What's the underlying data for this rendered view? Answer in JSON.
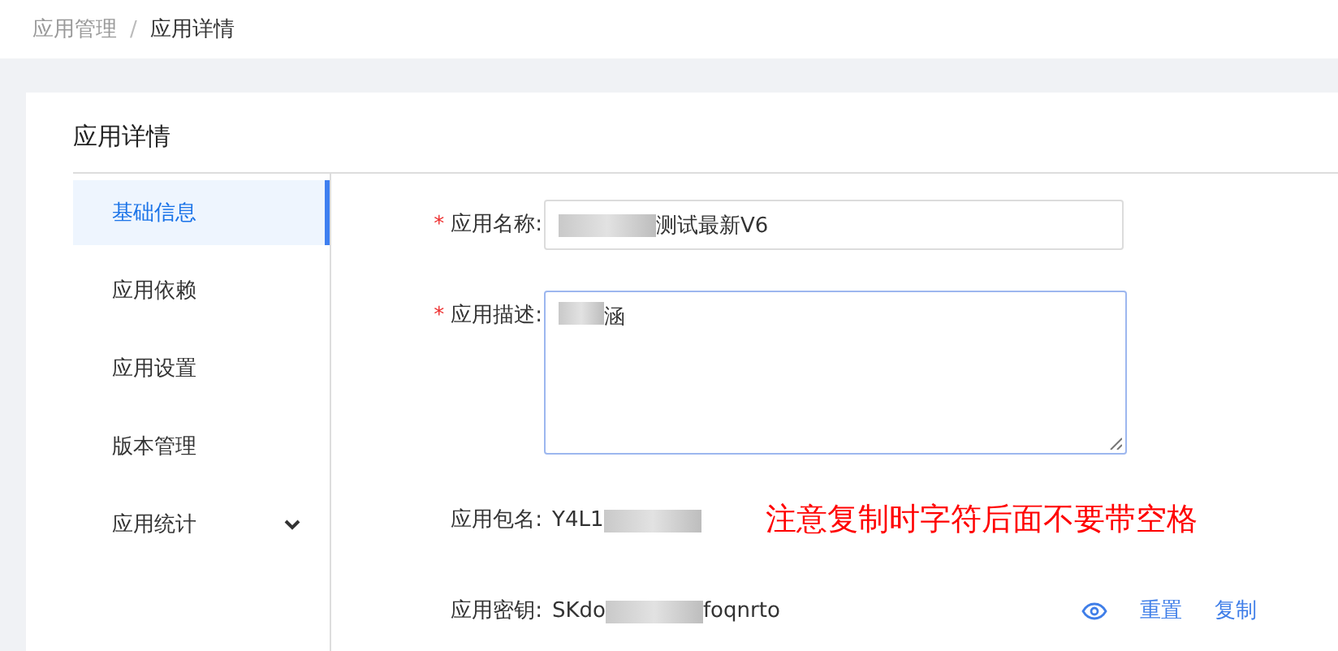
{
  "breadcrumb": [
    {
      "label": "应用管理",
      "current": false
    },
    {
      "label": "应用详情",
      "current": true
    }
  ],
  "breadcrumb_separator": "/",
  "required_mark": "*",
  "card": {
    "title": "应用详情"
  },
  "menu": [
    {
      "label": "基础信息",
      "selected": true,
      "kind": "item"
    },
    {
      "label": "应用依赖",
      "selected": false,
      "kind": "item"
    },
    {
      "label": "应用设置",
      "selected": false,
      "kind": "item"
    },
    {
      "label": "版本管理",
      "selected": false,
      "kind": "item"
    },
    {
      "label": "应用统计",
      "selected": false,
      "kind": "submenu"
    }
  ],
  "fields": [
    {
      "label": "应用名称:",
      "required": true,
      "kind": "input",
      "value": [
        {
          "kind": "blur"
        },
        {
          "kind": "text",
          "text": "测试最新V6"
        }
      ]
    },
    {
      "label": "应用描述:",
      "required": true,
      "kind": "textarea",
      "value": [
        {
          "kind": "blur"
        },
        {
          "kind": "text",
          "text": "涵"
        }
      ]
    },
    {
      "label": "应用包名:",
      "required": false,
      "kind": "text",
      "value": [
        {
          "kind": "text",
          "text": "Y4L1"
        },
        {
          "kind": "blur"
        }
      ],
      "note": "注意复制时字符后面不要带空格"
    },
    {
      "label": "应用密钥:",
      "required": false,
      "kind": "text",
      "value": [
        {
          "kind": "text",
          "text": "SKdo"
        },
        {
          "kind": "blur"
        },
        {
          "kind": "text",
          "text": "foqnrto"
        }
      ],
      "actions": [
        {
          "kind": "eye"
        },
        {
          "kind": "link",
          "label": "重置"
        },
        {
          "kind": "link",
          "label": "复制"
        }
      ]
    }
  ]
}
